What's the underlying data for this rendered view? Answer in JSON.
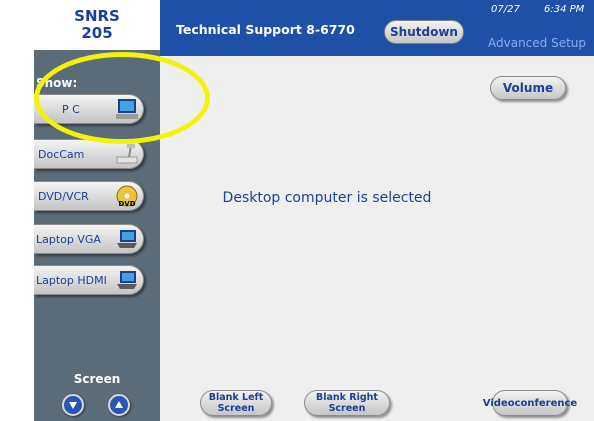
{
  "sidebar": {
    "room_line1": "SNRS",
    "room_line2": "205",
    "show_label": "Show:",
    "sources": [
      {
        "label": "P C",
        "icon": "desktop-pc-icon"
      },
      {
        "label": "DocCam",
        "icon": "document-camera-icon"
      },
      {
        "label": "DVD/VCR",
        "icon": "dvd-icon"
      },
      {
        "label": "Laptop VGA",
        "icon": "laptop-icon"
      },
      {
        "label": "Laptop HDMI",
        "icon": "laptop-icon"
      }
    ],
    "screen_label": "Screen",
    "screen_down_icon": "arrow-down-icon",
    "screen_up_icon": "arrow-up-icon"
  },
  "header": {
    "tech_support": "Technical Support 8-6770",
    "shutdown_label": "Shutdown",
    "date": "07/27",
    "time": "6:34 PM",
    "advanced_setup": "Advanced Setup"
  },
  "main": {
    "volume_label": "Volume",
    "status": "Desktop computer is selected",
    "blank_left": "Blank Left\nScreen",
    "blank_right": "Blank Right\nScreen",
    "videoconference": "Videoconference"
  },
  "colors": {
    "sidebar": "#5b6b77",
    "header": "#1f50a8",
    "main_bg": "#efefef",
    "text_blue": "#1c3f95",
    "highlight": "#f5f20a"
  }
}
